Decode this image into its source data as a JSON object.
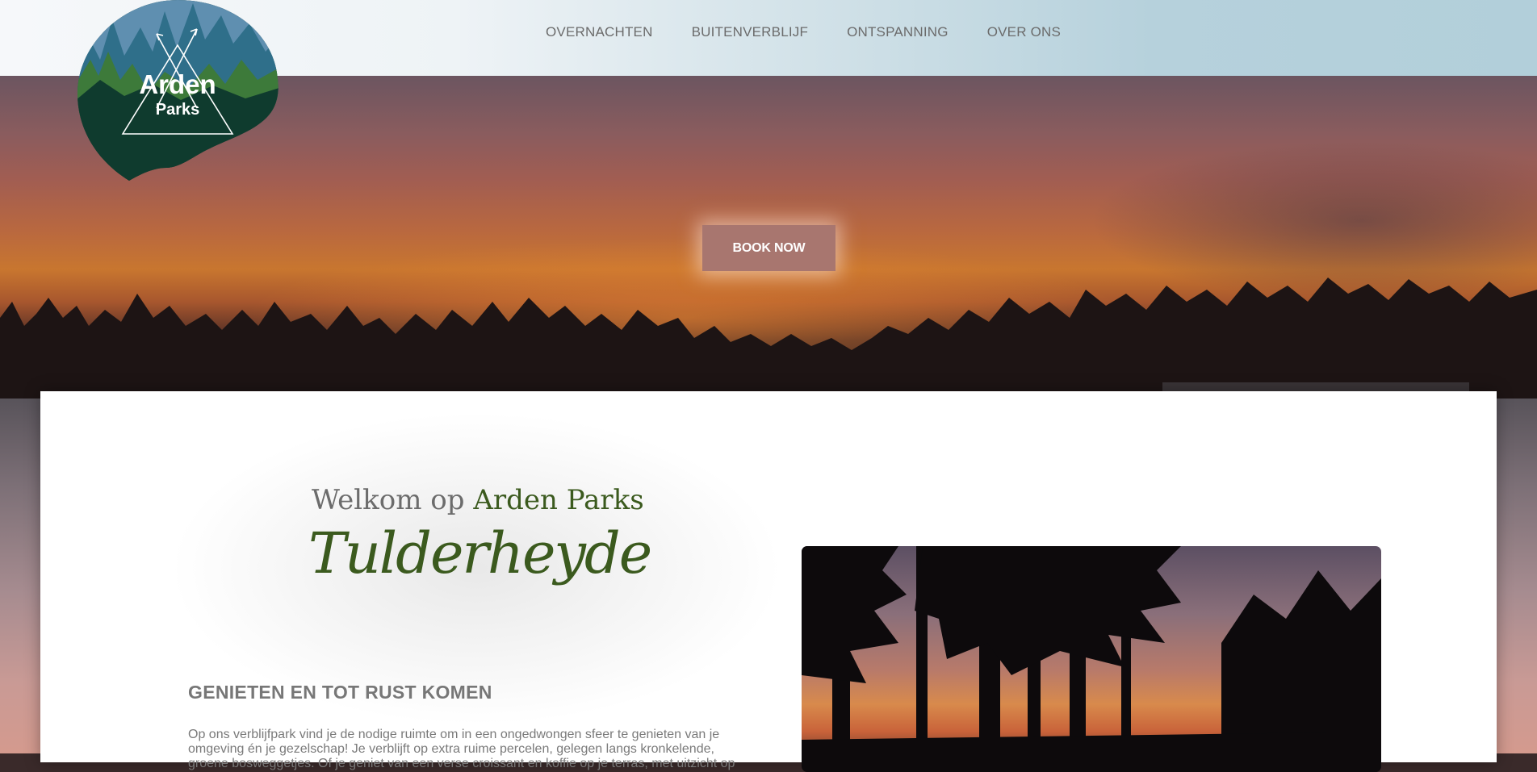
{
  "header": {
    "logo": {
      "line1": "Arden",
      "line2": "Parks"
    },
    "nav": [
      {
        "label": "OVERNACHTEN"
      },
      {
        "label": "BUITENVERBLIJF"
      },
      {
        "label": "ONTSPANNING"
      },
      {
        "label": "OVER ONS"
      }
    ]
  },
  "hero": {
    "cta_label": "BOOK NOW"
  },
  "intro": {
    "welcome_prefix": "Welkom op",
    "welcome_brand": "Arden Parks",
    "park_name": "Tulderheyde",
    "section_title": "GENIETEN EN TOT RUST KOMEN",
    "body": "Op ons verblijfpark vind je de nodige ruimte om in een ongedwongen sfeer te genieten van je omgeving én je gezelschap! Je verblijft op extra ruime percelen, gelegen langs kronkelende, groene bosweggetjes. Of je geniet van een verse croissant en koffie op je terras, met uitzicht op"
  },
  "colors": {
    "brand_green": "#3b5a1e",
    "logo_dark": "#0f3b2e",
    "cta_background": "#a8766f",
    "nav_text": "#6b6b6b"
  }
}
